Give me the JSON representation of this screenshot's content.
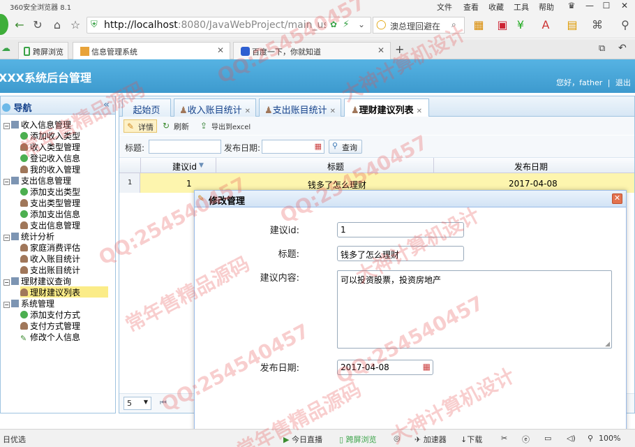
{
  "browser": {
    "title": "360安全浏览器 8.1",
    "menu": [
      "文件",
      "查看",
      "收藏",
      "工具",
      "帮助"
    ],
    "url_host": "http://localhost",
    "url_rest": ":8080/JavaWebProject/main_user.",
    "search_text": "澳总理回避在",
    "tabs": [
      {
        "label": "跨屏浏览"
      },
      {
        "label": "信息管理系统"
      },
      {
        "label": "百度一下，你就知道"
      }
    ]
  },
  "app": {
    "title": "XXX系统后台管理",
    "greeting": "您好，father",
    "logout": "退出"
  },
  "sidebar": {
    "title": "导航",
    "groups": [
      {
        "label": "收入信息管理",
        "items": [
          "添加收入类型",
          "收入类型管理",
          "登记收入信息",
          "我的收入管理"
        ]
      },
      {
        "label": "支出信息管理",
        "items": [
          "添加支出类型",
          "支出类型管理",
          "添加支出信息",
          "支出信息管理"
        ]
      },
      {
        "label": "统计分析",
        "items": [
          "家庭消费评估",
          "收入账目统计",
          "支出账目统计"
        ]
      },
      {
        "label": "理财建议查询",
        "items": [
          "理财建议列表"
        ]
      },
      {
        "label": "系统管理",
        "items": [
          "添加支付方式",
          "支付方式管理",
          "修改个人信息"
        ]
      }
    ]
  },
  "main": {
    "tabs": [
      {
        "label": "起始页"
      },
      {
        "label": "收入账目统计"
      },
      {
        "label": "支出账目统计"
      },
      {
        "label": "理财建议列表"
      }
    ],
    "toolbar": {
      "detail": "详情",
      "refresh": "刷新",
      "export": "导出到excel"
    },
    "filter": {
      "title_label": "标题:",
      "date_label": "发布日期:",
      "query": "查询"
    },
    "grid": {
      "columns": [
        "建议id",
        "标题",
        "发布日期"
      ],
      "rows": [
        {
          "num": "1",
          "id": "1",
          "title": "钱多了怎么理财",
          "date": "2017-04-08"
        }
      ]
    },
    "pager": {
      "page_size": "5"
    }
  },
  "dialog": {
    "title": "修改管理",
    "fields": {
      "id_label": "建议id:",
      "id_value": "1",
      "title_label": "标题:",
      "title_value": "钱多了怎么理财",
      "content_label": "建议内容:",
      "content_value": "可以投资股票，投资房地产",
      "date_label": "发布日期:",
      "date_value": "2017-04-08"
    }
  },
  "statusbar": {
    "left": "日优选",
    "items": [
      "今日直播",
      "跨屏浏览",
      "加速器",
      "下载"
    ],
    "zoom": "100%"
  },
  "watermarks": [
    "QQ:254540457",
    "大神计算机设计",
    "常年售精品源码"
  ]
}
